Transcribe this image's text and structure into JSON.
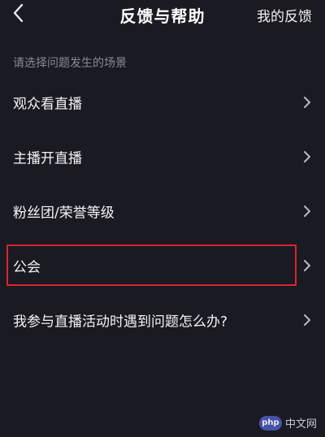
{
  "header": {
    "title": "反馈与帮助",
    "action_label": "我的反馈"
  },
  "section_hint": "请选择问题发生的场景",
  "list": {
    "items": [
      {
        "label": "观众看直播"
      },
      {
        "label": "主播开直播"
      },
      {
        "label": "粉丝团/荣誉等级"
      },
      {
        "label": "公会",
        "highlighted": true
      },
      {
        "label": "我参与直播活动时遇到问题怎么办?"
      }
    ]
  },
  "watermark": {
    "logo_text": "php",
    "site_text": "中文网"
  },
  "colors": {
    "background": "#1a1a22",
    "highlight_border": "#d8262c",
    "hint_text": "#8a8a96"
  }
}
